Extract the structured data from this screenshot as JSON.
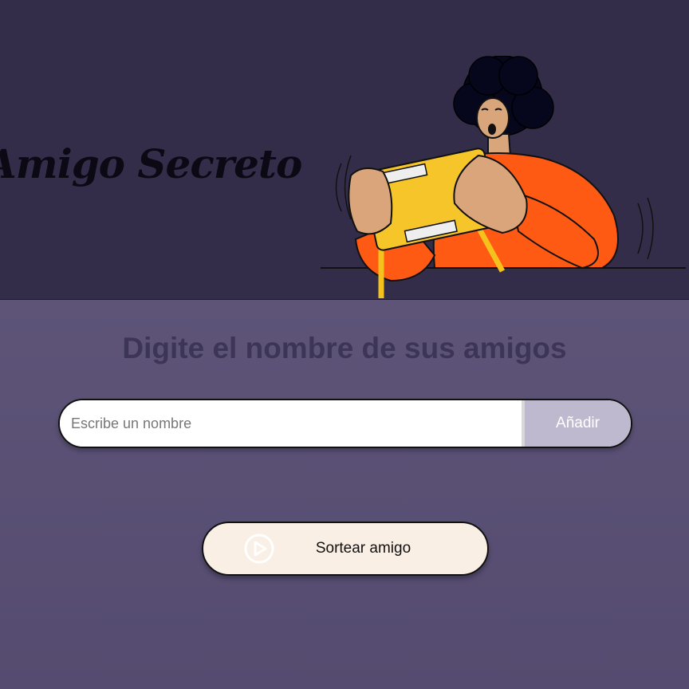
{
  "header": {
    "app_title": "Amigo Secreto",
    "illustration": "person-holding-gift-box-illustration"
  },
  "main": {
    "subtitle": "Digite el nombre de sus amigos",
    "name_input": {
      "value": "",
      "placeholder": "Escribe un nombre"
    },
    "add_button_label": "Añadir",
    "draw_button_label": "Sortear amigo",
    "draw_button_icon": "play-circle-icon"
  },
  "colors": {
    "header_bg": "#342d4a",
    "main_bg": "#5b5176",
    "add_button_bg": "#bfb9cf",
    "draw_button_bg": "#faefe5",
    "subtitle_text": "#3d3556"
  }
}
